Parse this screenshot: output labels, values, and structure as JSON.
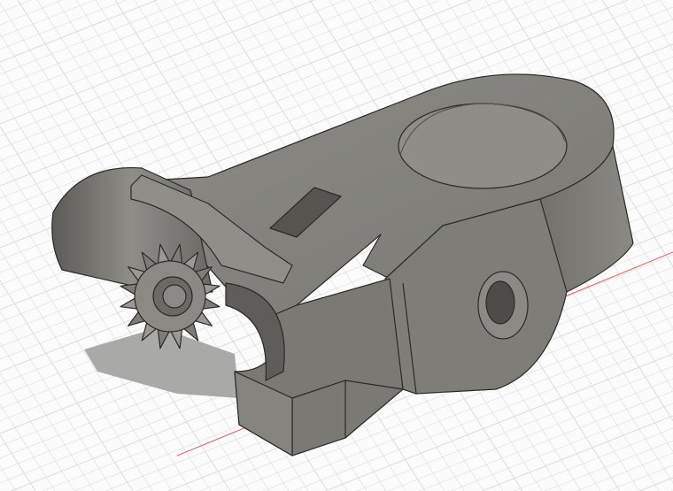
{
  "viewport": {
    "background": "#fbfbfb",
    "grid_color": "#dcdcdc",
    "axis_color": "#e06060"
  },
  "model": {
    "body_color": "#7d7c77",
    "edge_color": "#2a2a28"
  }
}
